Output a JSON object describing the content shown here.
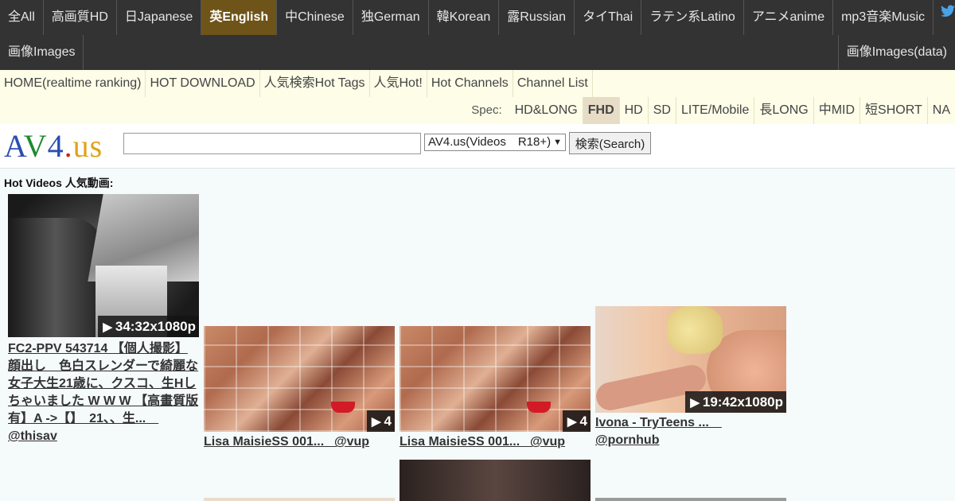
{
  "lang_nav": {
    "row1": [
      {
        "label": "全All",
        "active": false
      },
      {
        "label": "高画質HD",
        "active": false
      },
      {
        "label": "日Japanese",
        "active": false
      },
      {
        "label": "英English",
        "active": true
      },
      {
        "label": "中Chinese",
        "active": false
      },
      {
        "label": "独German",
        "active": false
      },
      {
        "label": "韓Korean",
        "active": false
      },
      {
        "label": "露Russian",
        "active": false
      },
      {
        "label": "タイThai",
        "active": false
      },
      {
        "label": "ラテン系Latino",
        "active": false
      },
      {
        "label": "アニメanime",
        "active": false
      },
      {
        "label": "mp3音楽Music",
        "active": false
      }
    ],
    "row2_left": "画像Images",
    "row2_right": "画像Images(data)"
  },
  "main_nav": [
    "HOME(realtime ranking)",
    "HOT DOWNLOAD",
    "人気検索Hot Tags",
    "人気Hot!",
    "Hot Channels",
    "Channel List"
  ],
  "spec": {
    "label": "Spec:",
    "options": [
      {
        "label": "HD&LONG",
        "active": false
      },
      {
        "label": "FHD",
        "active": true
      },
      {
        "label": "HD",
        "active": false
      },
      {
        "label": "SD",
        "active": false
      },
      {
        "label": "LITE/Mobile",
        "active": false
      },
      {
        "label": "長LONG",
        "active": false
      },
      {
        "label": "中MID",
        "active": false
      },
      {
        "label": "短SHORT",
        "active": false
      },
      {
        "label": "NA",
        "active": false
      }
    ]
  },
  "search": {
    "logo": {
      "p1": "A",
      "p2": "V",
      "p3": "4",
      "p4": ".",
      "p5": "us"
    },
    "value": "",
    "select_value": "AV4.us(Videos　R18+)",
    "button_label": "検索(Search)"
  },
  "content": {
    "section_title": "Hot Videos 人気動画:",
    "videos": [
      {
        "duration": "34:32x1080p",
        "title": "FC2-PPV 543714 【個人撮影】顔出し　色白スレンダーで綺麗な女子大生21歳に、クスコ、生Hしちゃいました W W W 【高畫質版有】A ->【】　21、、生...　",
        "source": "@thisav"
      },
      {
        "duration": "4",
        "title": "Lisa MaisieSS 001...　",
        "source": "@vup"
      },
      {
        "duration": "4",
        "title": "Lisa MaisieSS 001...　",
        "source": "@vup"
      },
      {
        "duration": "19:42x1080p",
        "title": "Ivona - TryTeens ...　",
        "source": "@pornhub"
      }
    ]
  },
  "colors": {
    "topbar": "#333333",
    "active_lang": "#6e5419",
    "navbar": "#fdfde8",
    "active_spec": "#e7dcc6",
    "page_bg": "#f5fafa"
  },
  "icons": {
    "play": "▶",
    "select_arrow": "▼"
  }
}
